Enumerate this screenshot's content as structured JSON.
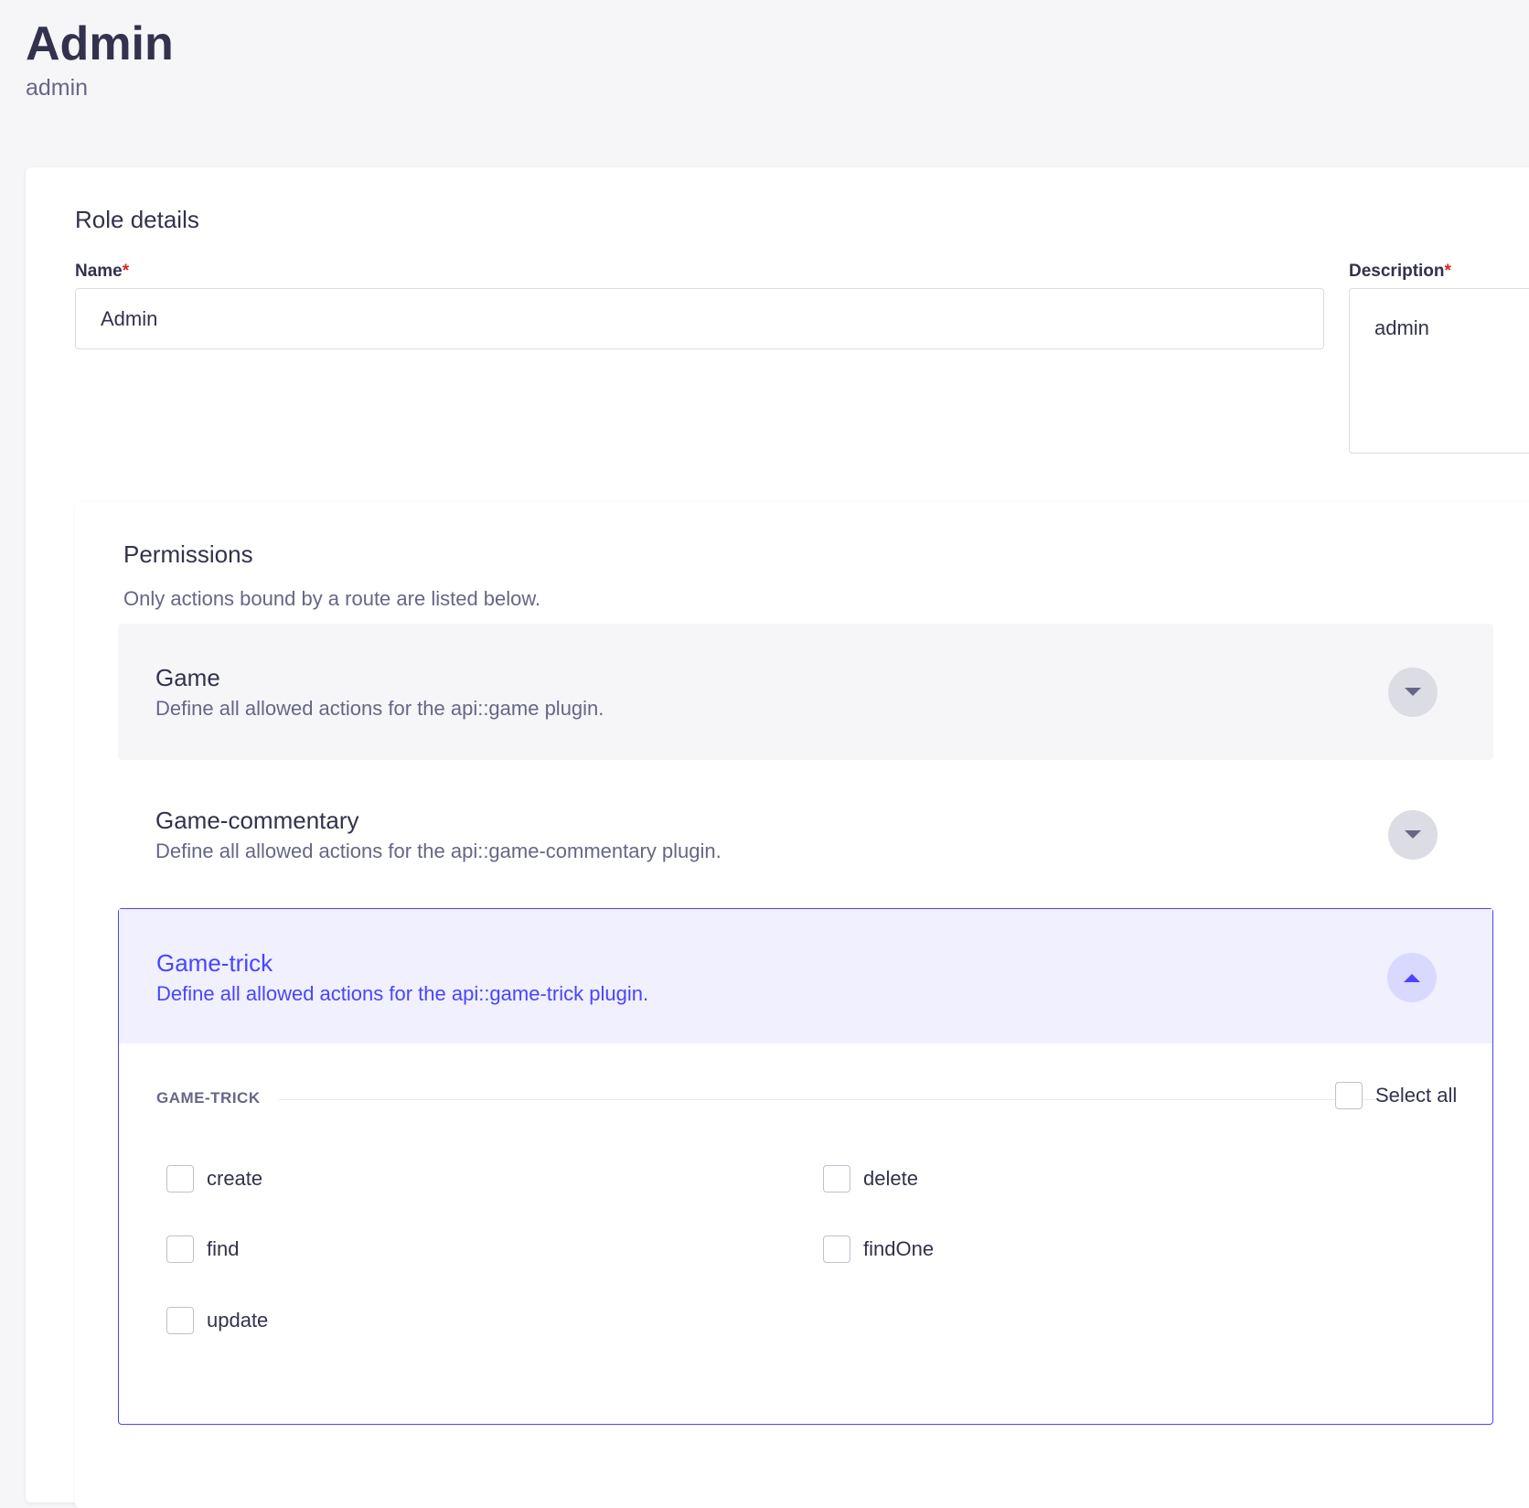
{
  "header": {
    "title": "Admin",
    "subtitle": "admin"
  },
  "role_details": {
    "section_title": "Role details",
    "name_label": "Name",
    "name_value": "Admin",
    "description_label": "Description",
    "description_value": "admin",
    "required_mark": "*"
  },
  "permissions": {
    "title": "Permissions",
    "subtitle": "Only actions bound by a route are listed below.",
    "plugins": [
      {
        "name": "Game",
        "description": "Define all allowed actions for the api::game plugin.",
        "expanded": false
      },
      {
        "name": "Game-commentary",
        "description": "Define all allowed actions for the api::game-commentary plugin.",
        "expanded": false
      },
      {
        "name": "Game-trick",
        "description": "Define all allowed actions for the api::game-trick plugin.",
        "expanded": true,
        "group_label": "GAME-TRICK",
        "select_all_label": "Select all",
        "select_all_checked": false,
        "actions": [
          {
            "label": "create",
            "checked": false
          },
          {
            "label": "delete",
            "checked": false
          },
          {
            "label": "find",
            "checked": false
          },
          {
            "label": "findOne",
            "checked": false
          },
          {
            "label": "update",
            "checked": false
          }
        ]
      }
    ]
  },
  "colors": {
    "accent": "#4945ff",
    "accent_bg": "#f0f0ff",
    "required": "#d02b20",
    "text_primary": "#32324d",
    "text_secondary": "#666687",
    "page_bg": "#f6f6f9"
  }
}
